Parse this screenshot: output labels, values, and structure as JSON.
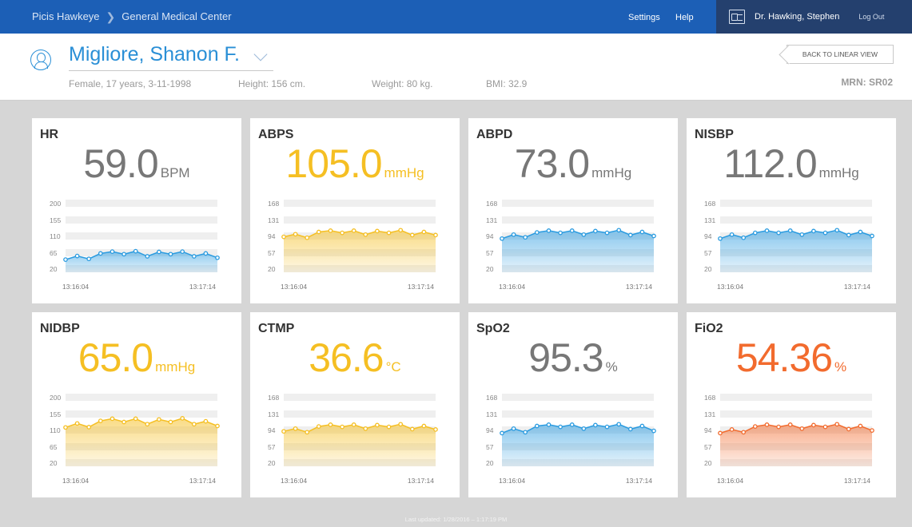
{
  "header": {
    "app_name": "Picis Hawkeye",
    "facility": "General Medical Center",
    "settings_label": "Settings",
    "help_label": "Help",
    "user_name": "Dr. Hawking, Stephen",
    "logout_label": "Log Out"
  },
  "patient": {
    "name": "Migliore, Shanon F.",
    "demographics": "Female, 17 years, 3-11-1998",
    "height": "Height: 156 cm.",
    "weight": "Weight: 80 kg.",
    "bmi": "BMI: 32.9",
    "back_button": "BACK TO LINEAR VIEW",
    "mrn": "MRN: SR02"
  },
  "colors": {
    "blue": "#2a9be0",
    "yellow": "#f5bf23",
    "orange": "#f26b2e",
    "gray": "#777777"
  },
  "vitals": [
    {
      "title": "HR",
      "value": "59.0",
      "unit": "BPM",
      "value_color": "gray",
      "chart_color": "blue",
      "ticks": [
        "200",
        "155",
        "110",
        "65",
        "20"
      ],
      "ylim": [
        20,
        200
      ],
      "values": [
        45,
        55,
        47,
        62,
        67,
        60,
        68,
        54,
        66,
        60,
        67,
        54,
        62,
        50
      ],
      "t_start": "13:16:04",
      "t_end": "13:17:14"
    },
    {
      "title": "ABPS",
      "value": "105.0",
      "unit": "mmHg",
      "value_color": "yellow",
      "chart_color": "yellow",
      "ticks": [
        "168",
        "131",
        "94",
        "57",
        "20"
      ],
      "ylim": [
        20,
        168
      ],
      "values": [
        92,
        98,
        90,
        103,
        106,
        101,
        106,
        97,
        105,
        101,
        107,
        96,
        103,
        96
      ],
      "t_start": "13:16:04",
      "t_end": "13:17:14"
    },
    {
      "title": "ABPD",
      "value": "73.0",
      "unit": "mmHg",
      "value_color": "gray",
      "chart_color": "blue",
      "ticks": [
        "168",
        "131",
        "94",
        "57",
        "20"
      ],
      "ylim": [
        20,
        168
      ],
      "values": [
        88,
        97,
        91,
        102,
        106,
        101,
        106,
        97,
        105,
        101,
        107,
        96,
        103,
        94
      ],
      "t_start": "13:16:04",
      "t_end": "13:17:14"
    },
    {
      "title": "NISBP",
      "value": "112.0",
      "unit": "mmHg",
      "value_color": "gray",
      "chart_color": "blue",
      "ticks": [
        "168",
        "131",
        "94",
        "57",
        "20"
      ],
      "ylim": [
        20,
        168
      ],
      "values": [
        88,
        97,
        90,
        101,
        106,
        101,
        106,
        97,
        105,
        101,
        107,
        96,
        103,
        94
      ],
      "t_start": "13:16:04",
      "t_end": "13:17:14"
    },
    {
      "title": "NIDBP",
      "value": "65.0",
      "unit": "mmHg",
      "value_color": "yellow",
      "chart_color": "yellow",
      "ticks": [
        "200",
        "155",
        "110",
        "65",
        "20"
      ],
      "ylim": [
        20,
        200
      ],
      "values": [
        117,
        128,
        118,
        135,
        141,
        132,
        141,
        126,
        139,
        132,
        142,
        126,
        134,
        121
      ],
      "t_start": "13:16:04",
      "t_end": "13:17:14"
    },
    {
      "title": "CTMP",
      "value": "36.6",
      "unit": "°C",
      "value_color": "yellow",
      "chart_color": "yellow",
      "ticks": [
        "168",
        "131",
        "94",
        "57",
        "20"
      ],
      "ylim": [
        20,
        168
      ],
      "values": [
        91,
        97,
        89,
        102,
        106,
        101,
        106,
        97,
        105,
        101,
        107,
        96,
        103,
        95
      ],
      "t_start": "13:16:04",
      "t_end": "13:17:14"
    },
    {
      "title": "SpO2",
      "value": "95.3",
      "unit": "%",
      "value_color": "gray",
      "chart_color": "blue",
      "ticks": [
        "168",
        "131",
        "94",
        "57",
        "20"
      ],
      "ylim": [
        20,
        168
      ],
      "values": [
        87,
        97,
        89,
        103,
        106,
        101,
        106,
        97,
        105,
        101,
        107,
        96,
        103,
        92
      ],
      "t_start": "13:16:04",
      "t_end": "13:17:14"
    },
    {
      "title": "FiO2",
      "value": "54.36",
      "unit": "%",
      "value_color": "orange",
      "chart_color": "orange",
      "ticks": [
        "168",
        "131",
        "94",
        "57",
        "20"
      ],
      "ylim": [
        20,
        168
      ],
      "values": [
        87,
        95,
        89,
        102,
        106,
        101,
        106,
        97,
        105,
        101,
        107,
        96,
        103,
        93
      ],
      "t_start": "13:16:04",
      "t_end": "13:17:14"
    }
  ],
  "footer": "Last updated: 1/28/2016 – 1:17:19 PM"
}
